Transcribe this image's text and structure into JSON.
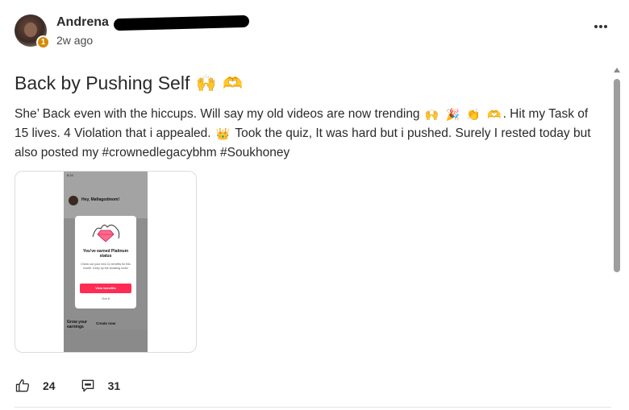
{
  "post": {
    "author": "Andrena",
    "level": "1",
    "time": "2w ago",
    "title": "Back by Pushing Self",
    "title_emojis": [
      "🙌",
      "🫶"
    ],
    "body": {
      "part1": "She’ Back even with the hiccups. Will say my old videos are now trending",
      "emojis1": [
        "🙌",
        "🎉",
        "👏",
        "🫶"
      ],
      "part2": ". Hit my Task of 15 lives. 4 Violation that i appealed.",
      "emoji2": "👑",
      "part3": "Took the quiz, It was hard but i pushed. Surely I rested today but also posted my #crownedlegacybhm #Soukhoney"
    }
  },
  "attachment": {
    "phone_time": "8:24",
    "greeting": "Hey, Mafiagodmom!",
    "modal_title": "You've earned Platinum status",
    "modal_desc": "Check out your new 11 benefits for this month. Keep up the amazing work!",
    "modal_button": "View benefits",
    "modal_dismiss": "Got it",
    "grow": "Grow your earnings",
    "create": "Create now"
  },
  "actions": {
    "likes": "24",
    "comments": "31"
  },
  "icons": {
    "more": "more-horizontal-icon",
    "like": "thumbs-up-icon",
    "comment": "comment-icon"
  },
  "colors": {
    "badge": "#d68a00",
    "accent": "#fe2c55"
  }
}
